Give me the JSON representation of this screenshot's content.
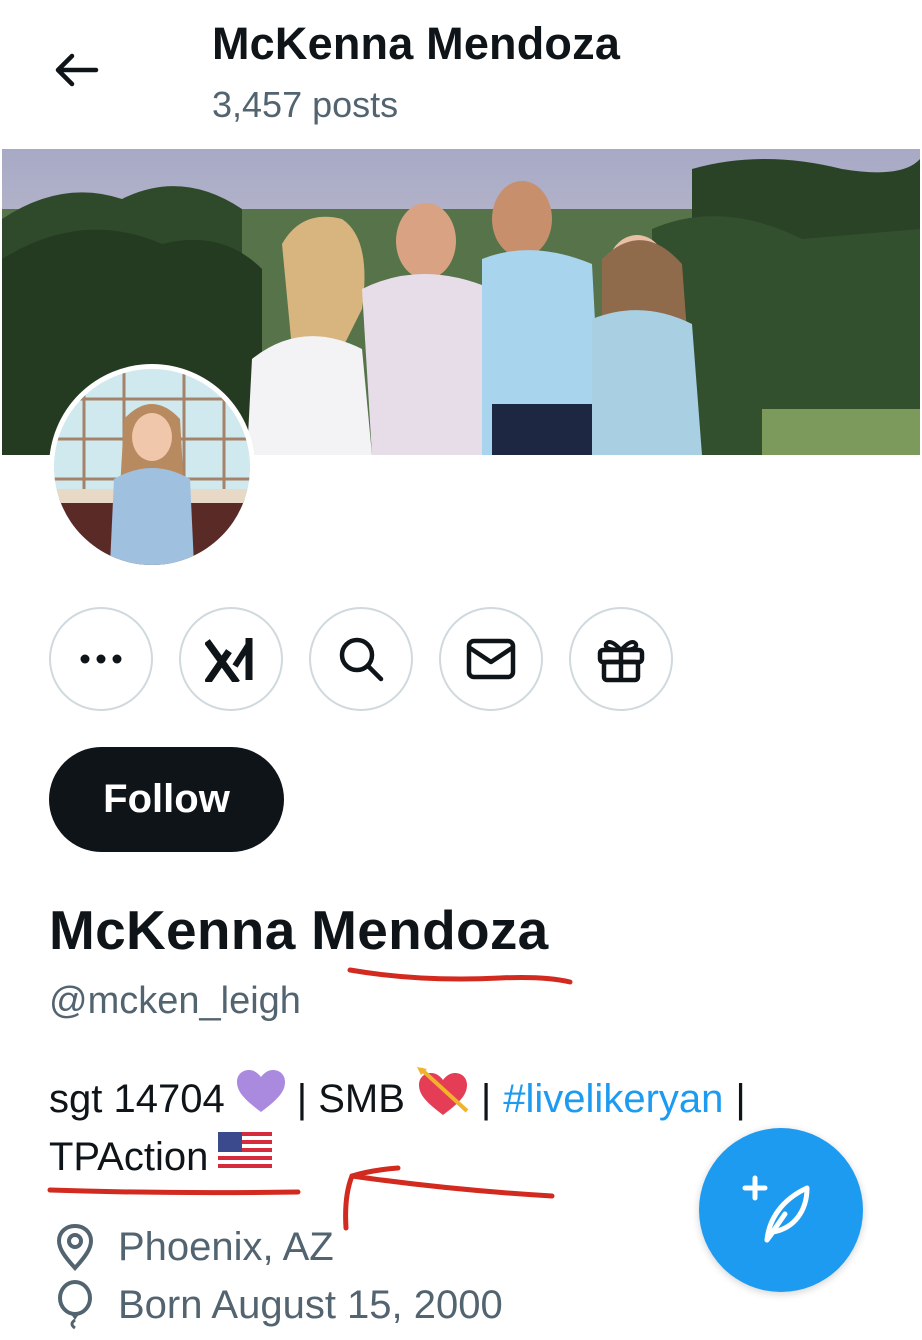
{
  "header": {
    "title": "McKenna Mendoza",
    "post_count": "3,457 posts"
  },
  "actions": {
    "more": "more-icon",
    "grok": "grok-icon",
    "search": "search-icon",
    "message": "mail-icon",
    "gift": "gift-icon"
  },
  "profile": {
    "follow_label": "Follow",
    "display_name": "McKenna Mendoza",
    "handle": "@mcken_leigh",
    "bio": {
      "part1": "sgt 14704",
      "sep1": "| SMB",
      "sep2": "|",
      "hashtag": "#livelikeryan",
      "sep3": "|",
      "part2": "TPAction"
    },
    "location": "Phoenix, AZ",
    "birthday": "Born August 15, 2000"
  },
  "colors": {
    "accent": "#1d9bf0",
    "text": "#0f1419",
    "secondary": "#536471",
    "annotation": "#d22a1f"
  }
}
